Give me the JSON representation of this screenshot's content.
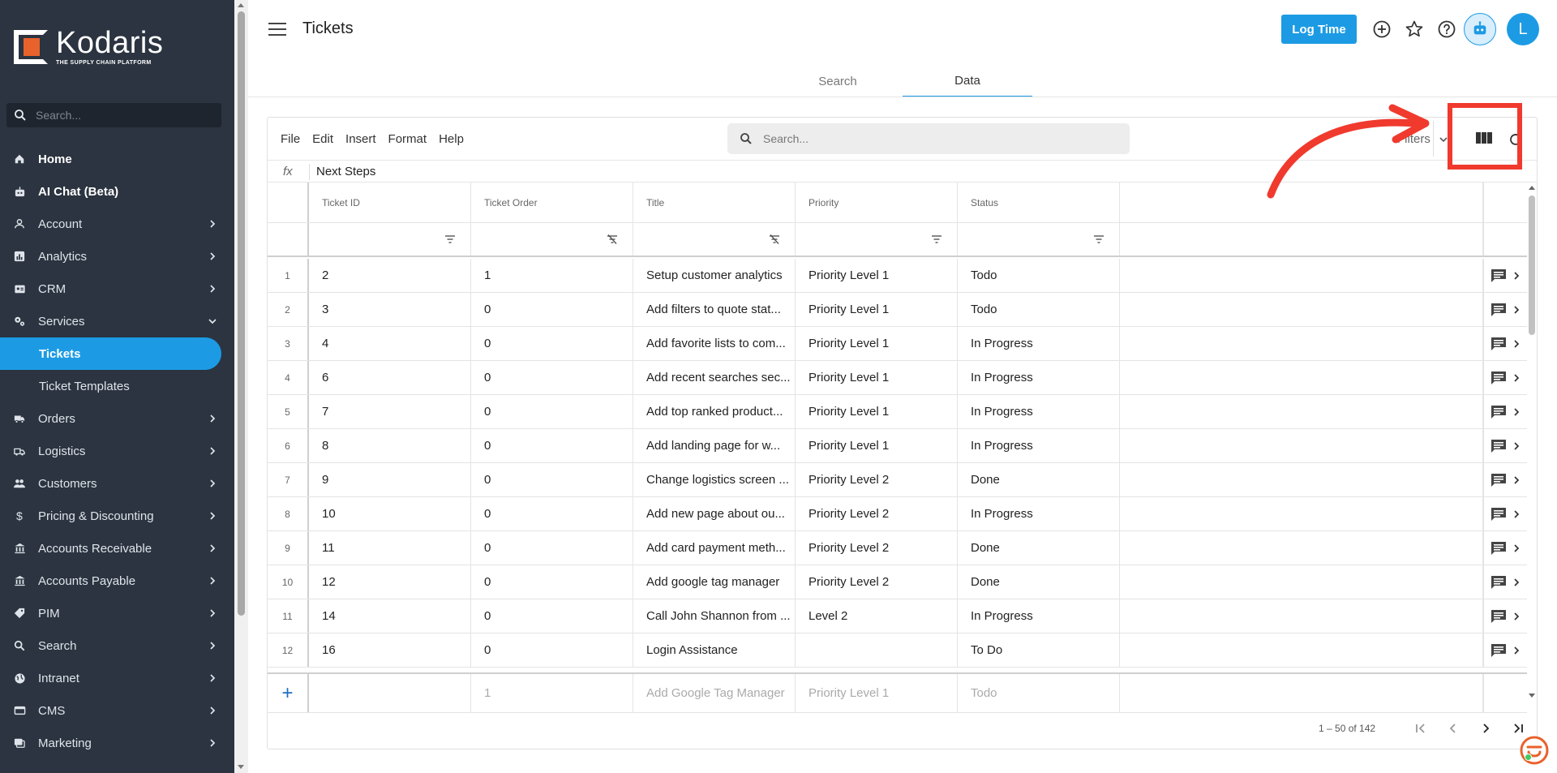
{
  "brand": {
    "name": "Kodaris",
    "tagline": "THE SUPPLY CHAIN PLATFORM"
  },
  "sidebar": {
    "search_placeholder": "Search...",
    "items": [
      {
        "label": "Home",
        "icon": "home-icon",
        "chevron": false
      },
      {
        "label": "AI Chat (Beta)",
        "icon": "robot-icon",
        "chevron": false
      },
      {
        "label": "Account",
        "icon": "user-icon",
        "chevron": true
      },
      {
        "label": "Analytics",
        "icon": "analytics-icon",
        "chevron": true
      },
      {
        "label": "CRM",
        "icon": "crm-icon",
        "chevron": true
      },
      {
        "label": "Services",
        "icon": "services-icon",
        "chevron": "open"
      },
      {
        "label": "Tickets",
        "icon": "",
        "chevron": false,
        "active": true
      },
      {
        "label": "Ticket Templates",
        "icon": "",
        "chevron": false
      },
      {
        "label": "Orders",
        "icon": "truck-icon",
        "chevron": true
      },
      {
        "label": "Logistics",
        "icon": "logistics-icon",
        "chevron": true
      },
      {
        "label": "Customers",
        "icon": "people-icon",
        "chevron": true
      },
      {
        "label": "Pricing & Discounting",
        "icon": "dollar-icon",
        "chevron": true
      },
      {
        "label": "Accounts Receivable",
        "icon": "bank-icon",
        "chevron": true
      },
      {
        "label": "Accounts Payable",
        "icon": "bank-icon",
        "chevron": true
      },
      {
        "label": "PIM",
        "icon": "tag-icon",
        "chevron": true
      },
      {
        "label": "Search",
        "icon": "search-icon",
        "chevron": true
      },
      {
        "label": "Intranet",
        "icon": "globe-icon",
        "chevron": true
      },
      {
        "label": "CMS",
        "icon": "cms-icon",
        "chevron": true
      },
      {
        "label": "Marketing",
        "icon": "marketing-icon",
        "chevron": true
      }
    ]
  },
  "header": {
    "title": "Tickets",
    "log_time_label": "Log Time",
    "avatar_initial": "L",
    "tabs": [
      {
        "label": "Search",
        "active": false
      },
      {
        "label": "Data",
        "active": true
      }
    ]
  },
  "sheet": {
    "menu": [
      "File",
      "Edit",
      "Insert",
      "Format",
      "Help"
    ],
    "search_placeholder": "Search...",
    "filters_label": "Filters",
    "fx_label": "fx",
    "fx_value": "Next Steps",
    "columns": [
      "Ticket ID",
      "Ticket Order",
      "Title",
      "Priority",
      "Status"
    ],
    "rows": [
      {
        "num": "1",
        "id": "2",
        "order": "1",
        "title": "Setup customer analytics",
        "priority": "Priority Level 1",
        "status": "Todo"
      },
      {
        "num": "2",
        "id": "3",
        "order": "0",
        "title": "Add filters to quote stat...",
        "priority": "Priority Level 1",
        "status": "Todo"
      },
      {
        "num": "3",
        "id": "4",
        "order": "0",
        "title": "Add favorite lists to com...",
        "priority": "Priority Level 1",
        "status": "In Progress"
      },
      {
        "num": "4",
        "id": "6",
        "order": "0",
        "title": "Add recent searches sec...",
        "priority": "Priority Level 1",
        "status": "In Progress"
      },
      {
        "num": "5",
        "id": "7",
        "order": "0",
        "title": "Add top ranked product...",
        "priority": "Priority Level 1",
        "status": "In Progress"
      },
      {
        "num": "6",
        "id": "8",
        "order": "0",
        "title": "Add landing page for w...",
        "priority": "Priority Level 1",
        "status": "In Progress"
      },
      {
        "num": "7",
        "id": "9",
        "order": "0",
        "title": "Change logistics screen ...",
        "priority": "Priority Level 2",
        "status": "Done"
      },
      {
        "num": "8",
        "id": "10",
        "order": "0",
        "title": "Add new page about ou...",
        "priority": "Priority Level 2",
        "status": "In Progress"
      },
      {
        "num": "9",
        "id": "11",
        "order": "0",
        "title": "Add card payment meth...",
        "priority": "Priority Level 2",
        "status": "Done"
      },
      {
        "num": "10",
        "id": "12",
        "order": "0",
        "title": "Add google tag manager",
        "priority": "Priority Level 2",
        "status": "Done"
      },
      {
        "num": "11",
        "id": "14",
        "order": "0",
        "title": "Call John Shannon from ...",
        "priority": "Level 2",
        "status": "In Progress"
      },
      {
        "num": "12",
        "id": "16",
        "order": "0",
        "title": "Login Assistance",
        "priority": "",
        "status": "To Do"
      }
    ],
    "new_row": {
      "plus": "+",
      "order": "1",
      "title": "Add Google Tag Manager",
      "priority": "Priority Level 1",
      "status": "Todo"
    },
    "pagination": "1 – 50 of 142"
  },
  "colors": {
    "accent": "#1c9be4",
    "sidebar_bg": "#2b3440",
    "annotation": "#f03a2e"
  }
}
